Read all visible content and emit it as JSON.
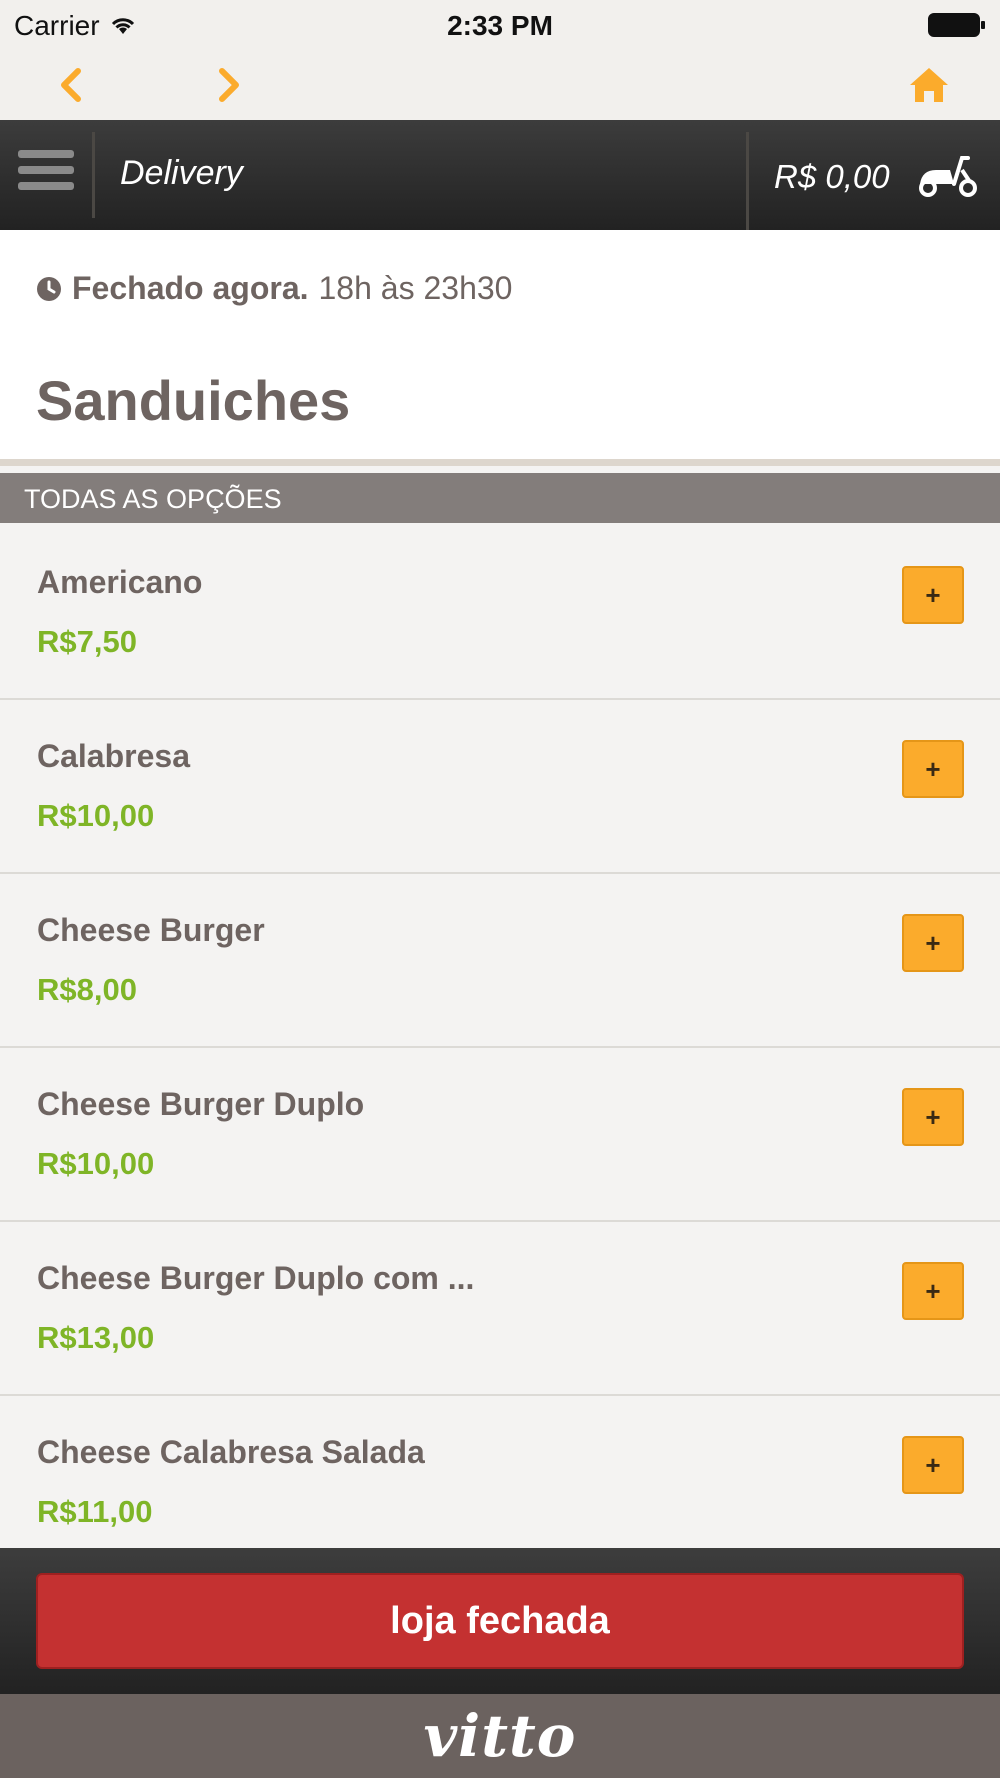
{
  "status_bar": {
    "carrier": "Carrier",
    "time": "2:33 PM"
  },
  "nav": {
    "back_icon": "chevron-left-icon",
    "forward_icon": "chevron-right-icon",
    "home_icon": "home-icon",
    "accent": "#fbab2c"
  },
  "header": {
    "menu_icon": "hamburger-icon",
    "title": "Delivery",
    "cart_total": "R$ 0,00",
    "delivery_icon": "scooter-icon"
  },
  "store": {
    "status": "Fechado agora.",
    "hours": "18h às 23h30"
  },
  "category": {
    "title": "Sanduiches",
    "section_label": "TODAS AS OPÇÕES"
  },
  "items": [
    {
      "name": "Americano",
      "price": "R$7,50",
      "add_label": "+"
    },
    {
      "name": "Calabresa",
      "price": "R$10,00",
      "add_label": "+"
    },
    {
      "name": "Cheese Burger",
      "price": "R$8,00",
      "add_label": "+"
    },
    {
      "name": "Cheese Burger Duplo",
      "price": "R$10,00",
      "add_label": "+"
    },
    {
      "name": "Cheese Burger Duplo com ...",
      "price": "R$13,00",
      "add_label": "+"
    },
    {
      "name": "Cheese Calabresa Salada",
      "price": "R$11,00",
      "add_label": "+"
    }
  ],
  "footer": {
    "button_label": "loja fechada",
    "button_color": "#c43131"
  },
  "brand": {
    "logo": "vitto"
  },
  "colors": {
    "price": "#7fb527",
    "add_button": "#fbab2c",
    "text": "#6e6461"
  }
}
